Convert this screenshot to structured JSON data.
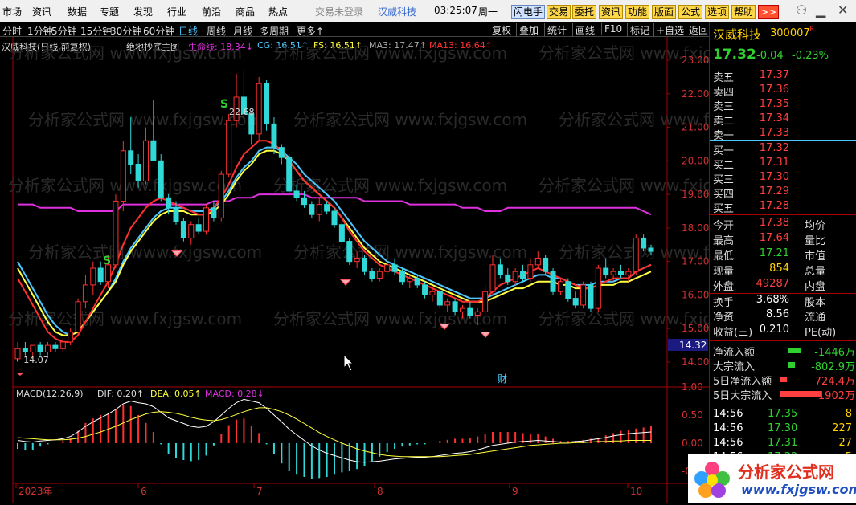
{
  "menu": [
    "市场",
    "资讯",
    "数据",
    "专题",
    "发现",
    "行业",
    "前沿",
    "商品",
    "热点"
  ],
  "login": "交易未登录",
  "title_stock": "汉威科技",
  "time": "03:25:07",
  "weekday": "周一",
  "toolbar": [
    "闪电手",
    "交易",
    "委托",
    "资讯",
    "功能",
    "版面",
    "公式",
    "选项",
    "帮助",
    ">>"
  ],
  "periods": [
    "分时",
    "1分钟",
    "5分钟",
    "15分钟",
    "30分钟",
    "60分钟",
    "日线",
    "周线",
    "月线",
    "多周期",
    "更多↑"
  ],
  "right_tools": [
    "复权",
    "叠加",
    "统计",
    "画线",
    "F10",
    "标记",
    "+自选",
    "返回"
  ],
  "info": {
    "name": "汉威科技(日线,前复权)",
    "formula": "绝地抄底主图",
    "life": "生命线: 18.34↓",
    "cg": "CG: 16.51↑",
    "fs": "FS: 16.51↑",
    "ma3": "MA3: 17.47↑",
    "ma13": "MA13: 16.64↑"
  },
  "macd_info": {
    "name": "MACD(12,26,9)",
    "dif": "DIF: 0.20↑",
    "dea": "DEA: 0.05↑",
    "macd": "MACD: 0.28↓"
  },
  "price_labels": [
    "23.00",
    "22.00",
    "21.00",
    "20.00",
    "19.00",
    "18.00",
    "17.00",
    "16.00",
    "15.00",
    "14.00"
  ],
  "macd_labels": [
    "1.00",
    "0.50",
    "0.00",
    "-0.50"
  ],
  "current_price_tag": "14.32",
  "annotations": {
    "high": "22.68",
    "low": "←14.07",
    "s": "S",
    "cai": "财"
  },
  "x_labels": [
    "2023年",
    "6",
    "7",
    "8",
    "9",
    "10"
  ],
  "watermark": "分析家公式网 www.fxjgsw.com",
  "quote": {
    "name": "汉威科技",
    "code": "300007",
    "code_flag": "R",
    "price": "17.32",
    "change": "-0.04",
    "pct": "-0.23%",
    "asks": [
      {
        "label": "卖五",
        "price": "17.37"
      },
      {
        "label": "卖四",
        "price": "17.36"
      },
      {
        "label": "卖三",
        "price": "17.35"
      },
      {
        "label": "卖二",
        "price": "17.34"
      },
      {
        "label": "卖一",
        "price": "17.33"
      }
    ],
    "bids": [
      {
        "label": "买一",
        "price": "17.32"
      },
      {
        "label": "买二",
        "price": "17.31"
      },
      {
        "label": "买三",
        "price": "17.30"
      },
      {
        "label": "买四",
        "price": "17.29"
      },
      {
        "label": "买五",
        "price": "17.28"
      }
    ],
    "stats": [
      {
        "l": "今开",
        "v": "17.38",
        "c": "red",
        "l2": "均价"
      },
      {
        "l": "最高",
        "v": "17.64",
        "c": "red",
        "l2": "量比"
      },
      {
        "l": "最低",
        "v": "17.21",
        "c": "green",
        "l2": "市值"
      },
      {
        "l": "现量",
        "v": "854",
        "c": "yellow",
        "l2": "总量"
      },
      {
        "l": "外盘",
        "v": "49287",
        "c": "red",
        "l2": "内盘"
      },
      {
        "l": "换手",
        "v": "3.68%",
        "c": "white",
        "l2": "股本"
      },
      {
        "l": "净资",
        "v": "8.56",
        "c": "white",
        "l2": "流通"
      },
      {
        "l": "收益(三)",
        "v": "0.210",
        "c": "white",
        "l2": "PE(动)"
      }
    ],
    "flows": [
      {
        "l": "净流入额",
        "v": "-1446万",
        "c": "green"
      },
      {
        "l": "大宗流入",
        "v": "-802.9万",
        "c": "green"
      },
      {
        "l": "5日净流入额",
        "v": "724.4万",
        "c": "red"
      },
      {
        "l": "5日大宗流入",
        "v": "1902万",
        "c": "red"
      }
    ],
    "ticks": [
      {
        "t": "14:56",
        "p": "17.35",
        "v": "8"
      },
      {
        "t": "14:56",
        "p": "17.30",
        "v": "227"
      },
      {
        "t": "14:56",
        "p": "17.31",
        "v": "27"
      },
      {
        "t": "14:56",
        "p": "17.32",
        "v": "5"
      }
    ]
  },
  "logo": {
    "text": "分析家公式网",
    "url": "www.fxjgsw.com"
  },
  "chart_data": {
    "type": "candlestick",
    "ylim": [
      13.5,
      23.3
    ],
    "ohlc": [
      [
        14.1,
        14.6,
        14.0,
        14.4
      ],
      [
        14.4,
        14.6,
        14.2,
        14.3
      ],
      [
        14.3,
        14.5,
        14.1,
        14.5
      ],
      [
        14.5,
        14.6,
        14.2,
        14.3
      ],
      [
        14.3,
        14.6,
        14.2,
        14.5
      ],
      [
        14.5,
        14.6,
        14.3,
        14.4
      ],
      [
        14.4,
        14.7,
        14.3,
        14.6
      ],
      [
        14.6,
        15.0,
        14.5,
        14.9
      ],
      [
        14.9,
        15.9,
        14.8,
        15.8
      ],
      [
        15.8,
        16.6,
        15.6,
        16.3
      ],
      [
        16.3,
        17.0,
        16.0,
        16.8
      ],
      [
        16.8,
        17.0,
        16.3,
        16.4
      ],
      [
        16.4,
        17.2,
        16.2,
        16.9
      ],
      [
        16.9,
        19.0,
        16.8,
        18.8
      ],
      [
        18.8,
        20.6,
        18.5,
        20.3
      ],
      [
        20.3,
        21.3,
        19.6,
        19.9
      ],
      [
        19.9,
        20.2,
        19.2,
        19.4
      ],
      [
        19.4,
        21.0,
        19.3,
        20.6
      ],
      [
        20.6,
        21.8,
        20.2,
        20.0
      ],
      [
        20.0,
        20.2,
        18.8,
        18.9
      ],
      [
        18.9,
        19.0,
        18.4,
        18.6
      ],
      [
        18.6,
        18.8,
        18.1,
        18.2
      ],
      [
        18.2,
        18.3,
        17.6,
        17.7
      ],
      [
        17.7,
        18.2,
        17.5,
        18.1
      ],
      [
        18.1,
        18.3,
        17.8,
        17.9
      ],
      [
        17.9,
        18.7,
        17.8,
        18.6
      ],
      [
        18.6,
        18.8,
        18.2,
        18.3
      ],
      [
        18.3,
        19.7,
        18.2,
        19.6
      ],
      [
        19.6,
        21.4,
        19.5,
        21.2
      ],
      [
        21.2,
        22.6,
        21.0,
        21.9
      ],
      [
        21.9,
        22.7,
        21.2,
        21.4
      ],
      [
        21.4,
        21.5,
        20.5,
        20.8
      ],
      [
        20.8,
        22.5,
        20.6,
        22.3
      ],
      [
        22.3,
        22.4,
        20.9,
        21.1
      ],
      [
        21.1,
        21.3,
        20.2,
        20.4
      ],
      [
        20.4,
        20.5,
        19.9,
        20.1
      ],
      [
        20.1,
        20.2,
        19.0,
        19.1
      ],
      [
        19.1,
        19.3,
        18.8,
        18.9
      ],
      [
        18.9,
        19.1,
        18.6,
        18.7
      ],
      [
        18.7,
        18.8,
        18.3,
        18.4
      ],
      [
        18.4,
        18.9,
        18.2,
        18.7
      ],
      [
        18.7,
        18.8,
        18.4,
        18.5
      ],
      [
        18.5,
        18.6,
        18.0,
        18.1
      ],
      [
        18.1,
        18.2,
        17.5,
        17.6
      ],
      [
        17.6,
        17.7,
        16.9,
        17.0
      ],
      [
        17.0,
        17.3,
        16.8,
        17.1
      ],
      [
        17.1,
        17.2,
        16.6,
        16.7
      ],
      [
        16.7,
        16.8,
        16.4,
        16.5
      ],
      [
        16.5,
        16.8,
        16.4,
        16.7
      ],
      [
        16.7,
        17.0,
        16.6,
        16.9
      ],
      [
        16.9,
        17.1,
        16.6,
        16.7
      ],
      [
        16.7,
        16.8,
        16.3,
        16.4
      ],
      [
        16.4,
        16.6,
        16.2,
        16.5
      ],
      [
        16.5,
        16.6,
        16.2,
        16.3
      ],
      [
        16.3,
        16.4,
        15.9,
        16.0
      ],
      [
        16.0,
        16.2,
        15.8,
        16.1
      ],
      [
        16.1,
        16.2,
        15.6,
        15.7
      ],
      [
        15.7,
        15.9,
        15.5,
        15.8
      ],
      [
        15.8,
        15.9,
        15.4,
        15.5
      ],
      [
        15.5,
        15.7,
        15.3,
        15.6
      ],
      [
        15.6,
        15.8,
        15.3,
        15.4
      ],
      [
        15.4,
        15.6,
        15.1,
        15.5
      ],
      [
        15.5,
        16.3,
        15.4,
        16.1
      ],
      [
        16.1,
        17.2,
        16.0,
        16.9
      ],
      [
        16.9,
        17.1,
        16.5,
        16.6
      ],
      [
        16.6,
        16.8,
        16.3,
        16.4
      ],
      [
        16.4,
        16.8,
        16.3,
        16.7
      ],
      [
        16.7,
        16.9,
        16.4,
        16.5
      ],
      [
        16.5,
        17.1,
        16.4,
        16.9
      ],
      [
        16.9,
        17.3,
        16.8,
        17.1
      ],
      [
        17.1,
        17.2,
        16.6,
        16.7
      ],
      [
        16.7,
        16.8,
        16.0,
        16.1
      ],
      [
        16.1,
        16.5,
        16.0,
        16.4
      ],
      [
        16.4,
        16.5,
        15.8,
        15.9
      ],
      [
        15.9,
        16.1,
        15.6,
        15.7
      ],
      [
        15.7,
        16.4,
        15.6,
        16.3
      ],
      [
        16.3,
        16.4,
        15.5,
        15.6
      ],
      [
        15.6,
        16.9,
        15.5,
        16.8
      ],
      [
        16.8,
        17.1,
        16.5,
        16.6
      ],
      [
        16.6,
        16.8,
        16.4,
        16.7
      ],
      [
        16.7,
        16.9,
        16.5,
        16.6
      ],
      [
        16.6,
        16.8,
        16.4,
        16.7
      ],
      [
        16.7,
        17.8,
        16.6,
        17.7
      ],
      [
        17.7,
        17.8,
        17.3,
        17.4
      ],
      [
        17.4,
        17.5,
        17.2,
        17.3
      ]
    ],
    "lines": [
      {
        "name": "生命线",
        "color": "#e030e0",
        "values": [
          18.7,
          18.7,
          18.7,
          18.6,
          18.6,
          18.6,
          18.6,
          18.6,
          18.5,
          18.5,
          18.5,
          18.5,
          18.5,
          18.5,
          18.7,
          18.7,
          18.7,
          18.7,
          18.7,
          18.7,
          18.7,
          18.7,
          18.7,
          18.7,
          18.7,
          18.7,
          18.8,
          18.8,
          18.8,
          18.9,
          18.9,
          18.9,
          19.0,
          19.0,
          19.0,
          19.0,
          19.0,
          19.0,
          19.0,
          18.9,
          18.9,
          18.9,
          18.9,
          18.9,
          18.9,
          18.9,
          18.8,
          18.8,
          18.8,
          18.8,
          18.8,
          18.8,
          18.7,
          18.7,
          18.7,
          18.7,
          18.7,
          18.7,
          18.7,
          18.6,
          18.6,
          18.6,
          18.5,
          18.5,
          18.5,
          18.6,
          18.6,
          18.6,
          18.6,
          18.6,
          18.6,
          18.6,
          18.6,
          18.6,
          18.6,
          18.6,
          18.6,
          18.6,
          18.6,
          18.6,
          18.6,
          18.6,
          18.6,
          18.5,
          18.4
        ]
      },
      {
        "name": "CG",
        "color": "#4cc8ff",
        "values": [
          17.0,
          16.6,
          16.2,
          15.8,
          15.4,
          15.1,
          14.9,
          14.8,
          14.9,
          15.2,
          15.5,
          15.8,
          16.1,
          16.5,
          17.0,
          17.4,
          17.7,
          18.0,
          18.3,
          18.5,
          18.6,
          18.6,
          18.6,
          18.5,
          18.5,
          18.5,
          18.6,
          18.8,
          19.1,
          19.5,
          19.8,
          20.0,
          20.3,
          20.4,
          20.4,
          20.3,
          20.1,
          19.9,
          19.6,
          19.4,
          19.2,
          19.0,
          18.8,
          18.5,
          18.2,
          17.9,
          17.6,
          17.4,
          17.2,
          17.0,
          16.9,
          16.8,
          16.7,
          16.6,
          16.5,
          16.4,
          16.3,
          16.2,
          16.1,
          16.0,
          15.9,
          15.9,
          15.9,
          16.0,
          16.1,
          16.2,
          16.3,
          16.4,
          16.5,
          16.6,
          16.6,
          16.5,
          16.5,
          16.4,
          16.3,
          16.3,
          16.3,
          16.4,
          16.4,
          16.4,
          16.5,
          16.5,
          16.7,
          16.8,
          16.9
        ]
      },
      {
        "name": "FS",
        "color": "#ffff40",
        "values": [
          16.8,
          16.4,
          16.0,
          15.6,
          15.2,
          14.9,
          14.8,
          14.8,
          14.9,
          15.2,
          15.5,
          15.8,
          16.1,
          16.4,
          16.9,
          17.3,
          17.6,
          17.9,
          18.2,
          18.4,
          18.5,
          18.5,
          18.5,
          18.4,
          18.4,
          18.4,
          18.5,
          18.7,
          19.0,
          19.4,
          19.7,
          19.9,
          20.2,
          20.3,
          20.3,
          20.2,
          20.0,
          19.7,
          19.4,
          19.2,
          19.0,
          18.8,
          18.6,
          18.3,
          18.0,
          17.7,
          17.4,
          17.2,
          17.0,
          16.9,
          16.8,
          16.7,
          16.6,
          16.5,
          16.4,
          16.3,
          16.2,
          16.1,
          16.0,
          15.9,
          15.8,
          15.8,
          15.8,
          15.9,
          16.0,
          16.1,
          16.2,
          16.2,
          16.3,
          16.4,
          16.4,
          16.4,
          16.3,
          16.3,
          16.2,
          16.2,
          16.2,
          16.3,
          16.3,
          16.3,
          16.4,
          16.4,
          16.5,
          16.6,
          16.7
        ]
      },
      {
        "name": "MA13",
        "color": "#ff3030",
        "values": [
          16.5,
          16.1,
          15.7,
          15.3,
          14.9,
          14.7,
          14.6,
          14.6,
          14.8,
          15.2,
          15.6,
          16.0,
          16.4,
          16.9,
          17.5,
          18.0,
          18.3,
          18.6,
          18.8,
          18.9,
          18.8,
          18.7,
          18.6,
          18.5,
          18.4,
          18.4,
          18.6,
          18.9,
          19.3,
          19.8,
          20.2,
          20.4,
          20.6,
          20.6,
          20.5,
          20.3,
          20.0,
          19.7,
          19.4,
          19.2,
          19.0,
          18.8,
          18.6,
          18.3,
          17.9,
          17.6,
          17.3,
          17.1,
          16.9,
          16.8,
          16.7,
          16.6,
          16.5,
          16.4,
          16.3,
          16.2,
          16.1,
          16.0,
          15.9,
          15.8,
          15.8,
          15.8,
          15.9,
          16.1,
          16.3,
          16.4,
          16.5,
          16.6,
          16.7,
          16.8,
          16.7,
          16.6,
          16.5,
          16.4,
          16.3,
          16.2,
          16.2,
          16.3,
          16.4,
          16.5,
          16.5,
          16.5,
          16.7,
          16.8,
          16.9
        ]
      }
    ],
    "macd": {
      "dif": [
        0.05,
        0.03,
        0.02,
        0.04,
        0.05,
        0.06,
        0.08,
        0.12,
        0.2,
        0.3,
        0.38,
        0.45,
        0.52,
        0.6,
        0.7,
        0.75,
        0.72,
        0.7,
        0.65,
        0.55,
        0.45,
        0.4,
        0.35,
        0.3,
        0.28,
        0.3,
        0.38,
        0.5,
        0.62,
        0.72,
        0.78,
        0.75,
        0.72,
        0.62,
        0.5,
        0.38,
        0.25,
        0.15,
        0.05,
        -0.05,
        -0.12,
        -0.18,
        -0.22,
        -0.26,
        -0.3,
        -0.33,
        -0.34,
        -0.33,
        -0.32,
        -0.3,
        -0.28,
        -0.27,
        -0.26,
        -0.25,
        -0.25,
        -0.24,
        -0.22,
        -0.2,
        -0.18,
        -0.17,
        -0.15,
        -0.12,
        -0.08,
        -0.04,
        -0.02,
        0.0,
        0.02,
        0.03,
        0.04,
        0.05,
        0.04,
        0.03,
        0.02,
        0.02,
        0.03,
        0.04,
        0.06,
        0.08,
        0.1,
        0.13,
        0.15,
        0.17,
        0.18,
        0.19,
        0.2
      ],
      "dea": [
        0.1,
        0.09,
        0.08,
        0.07,
        0.06,
        0.06,
        0.06,
        0.07,
        0.09,
        0.12,
        0.16,
        0.2,
        0.25,
        0.3,
        0.36,
        0.42,
        0.47,
        0.52,
        0.55,
        0.56,
        0.55,
        0.53,
        0.5,
        0.46,
        0.43,
        0.41,
        0.4,
        0.42,
        0.46,
        0.51,
        0.56,
        0.6,
        0.63,
        0.63,
        0.6,
        0.56,
        0.5,
        0.43,
        0.35,
        0.27,
        0.19,
        0.12,
        0.06,
        0.0,
        -0.05,
        -0.1,
        -0.14,
        -0.17,
        -0.2,
        -0.22,
        -0.23,
        -0.24,
        -0.24,
        -0.24,
        -0.24,
        -0.24,
        -0.24,
        -0.23,
        -0.22,
        -0.21,
        -0.2,
        -0.18,
        -0.16,
        -0.14,
        -0.12,
        -0.1,
        -0.08,
        -0.06,
        -0.04,
        -0.03,
        -0.02,
        -0.01,
        0.0,
        0.0,
        0.01,
        0.01,
        0.02,
        0.03,
        0.03,
        0.04,
        0.04,
        0.05,
        0.05,
        0.05,
        0.05
      ],
      "ylim": [
        -0.7,
        1.3
      ]
    }
  }
}
